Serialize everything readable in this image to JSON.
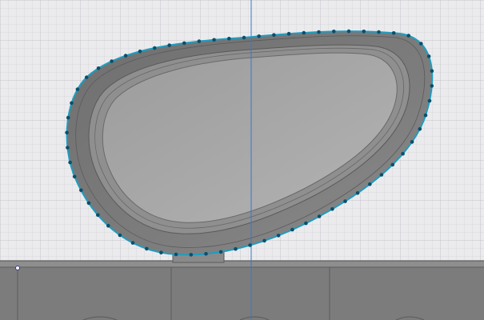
{
  "viewport": {
    "background_color": "#ebebed",
    "grid_minor_color": "#d8d8dc",
    "grid_major_color": "#c4c4ca",
    "axis_color": "#3a78c8",
    "ring_color": "#7a7a7a",
    "ring_dark_color": "#5e5e5e",
    "inner_face_color": "#a9a9a9",
    "selection_outline_color": "#1f9dc0",
    "control_point_color": "#0b4f6c",
    "base_panel_color": "#7c7c7c",
    "base_line_color": "#5b5b5b"
  },
  "selection": {
    "tool": "spline-fit-curve",
    "control_points_visible": true
  }
}
